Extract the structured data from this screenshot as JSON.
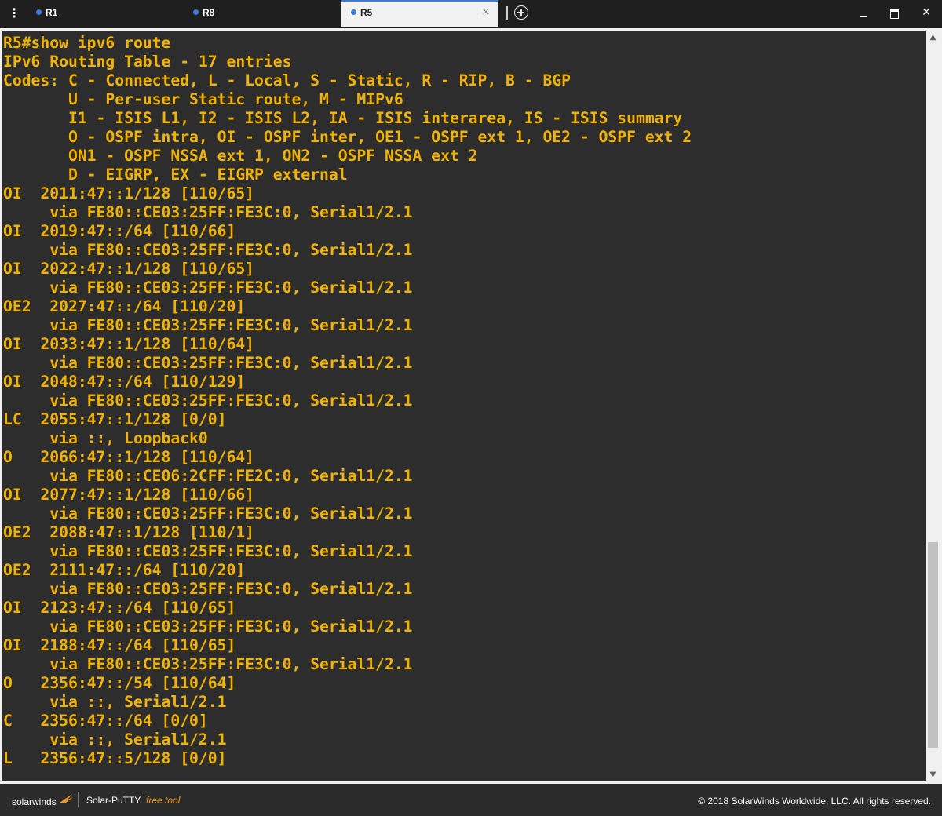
{
  "window": {
    "menu_icon": "vertical-dots-icon",
    "close_glyph": "✕"
  },
  "tabs": [
    {
      "label": "R1",
      "active": false
    },
    {
      "label": "R8",
      "active": false
    },
    {
      "label": "R5",
      "active": true
    }
  ],
  "tab_close_glyph": "×",
  "colors": {
    "terminal_bg": "#2d2d2d",
    "terminal_text": "#f2b200",
    "tab_dot": "#3a7bd5",
    "footer_bg": "#2b2b2b",
    "brand_orange": "#f29a1e"
  },
  "terminal": {
    "lines": [
      "R5#show ipv6 route",
      "IPv6 Routing Table - 17 entries",
      "Codes: C - Connected, L - Local, S - Static, R - RIP, B - BGP",
      "       U - Per-user Static route, M - MIPv6",
      "       I1 - ISIS L1, I2 - ISIS L2, IA - ISIS interarea, IS - ISIS summary",
      "       O - OSPF intra, OI - OSPF inter, OE1 - OSPF ext 1, OE2 - OSPF ext 2",
      "       ON1 - OSPF NSSA ext 1, ON2 - OSPF NSSA ext 2",
      "       D - EIGRP, EX - EIGRP external",
      "OI  2011:47::1/128 [110/65]",
      "     via FE80::CE03:25FF:FE3C:0, Serial1/2.1",
      "OI  2019:47::/64 [110/66]",
      "     via FE80::CE03:25FF:FE3C:0, Serial1/2.1",
      "OI  2022:47::1/128 [110/65]",
      "     via FE80::CE03:25FF:FE3C:0, Serial1/2.1",
      "OE2  2027:47::/64 [110/20]",
      "     via FE80::CE03:25FF:FE3C:0, Serial1/2.1",
      "OI  2033:47::1/128 [110/64]",
      "     via FE80::CE03:25FF:FE3C:0, Serial1/2.1",
      "OI  2048:47::/64 [110/129]",
      "     via FE80::CE03:25FF:FE3C:0, Serial1/2.1",
      "LC  2055:47::1/128 [0/0]",
      "     via ::, Loopback0",
      "O   2066:47::1/128 [110/64]",
      "     via FE80::CE06:2CFF:FE2C:0, Serial1/2.1",
      "OI  2077:47::1/128 [110/66]",
      "     via FE80::CE03:25FF:FE3C:0, Serial1/2.1",
      "OE2  2088:47::1/128 [110/1]",
      "     via FE80::CE03:25FF:FE3C:0, Serial1/2.1",
      "OE2  2111:47::/64 [110/20]",
      "     via FE80::CE03:25FF:FE3C:0, Serial1/2.1",
      "OI  2123:47::/64 [110/65]",
      "     via FE80::CE03:25FF:FE3C:0, Serial1/2.1",
      "OI  2188:47::/64 [110/65]",
      "     via FE80::CE03:25FF:FE3C:0, Serial1/2.1",
      "O   2356:47::/54 [110/64]",
      "     via ::, Serial1/2.1",
      "C   2356:47::/64 [0/0]",
      "     via ::, Serial1/2.1",
      "L   2356:47::5/128 [0/0]"
    ]
  },
  "scrollbar": {
    "up_glyph": "▲",
    "down_glyph": "▼",
    "position_fraction": 0.73
  },
  "footer": {
    "logo_text": "solarwinds",
    "product": "Solar-PuTTY",
    "free_tool": "free tool",
    "copyright": "© 2018 SolarWinds Worldwide, LLC. All rights reserved."
  }
}
